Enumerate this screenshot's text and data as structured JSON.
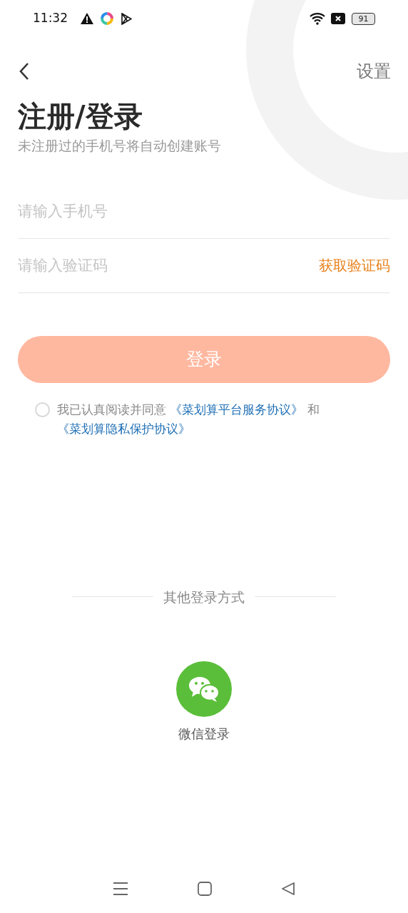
{
  "status_bar": {
    "time": "11:32",
    "battery": "91"
  },
  "header": {
    "settings": "设置"
  },
  "title": "注册/登录",
  "subtitle": "未注册过的手机号将自动创建账号",
  "phone_field": {
    "placeholder": "请输入手机号"
  },
  "code_field": {
    "placeholder": "请输入验证码",
    "action": "获取验证码"
  },
  "login_button": {
    "label": "登录",
    "disabled": true
  },
  "agreement": {
    "checked": false,
    "text": "我已认真阅读并同意",
    "links": [
      "《菜划算平台服务协议》",
      "《菜划算隐私保护协议》"
    ],
    "conjunction": "和"
  },
  "other_login": {
    "label": "其他登录方式",
    "wechat": "微信登录"
  }
}
